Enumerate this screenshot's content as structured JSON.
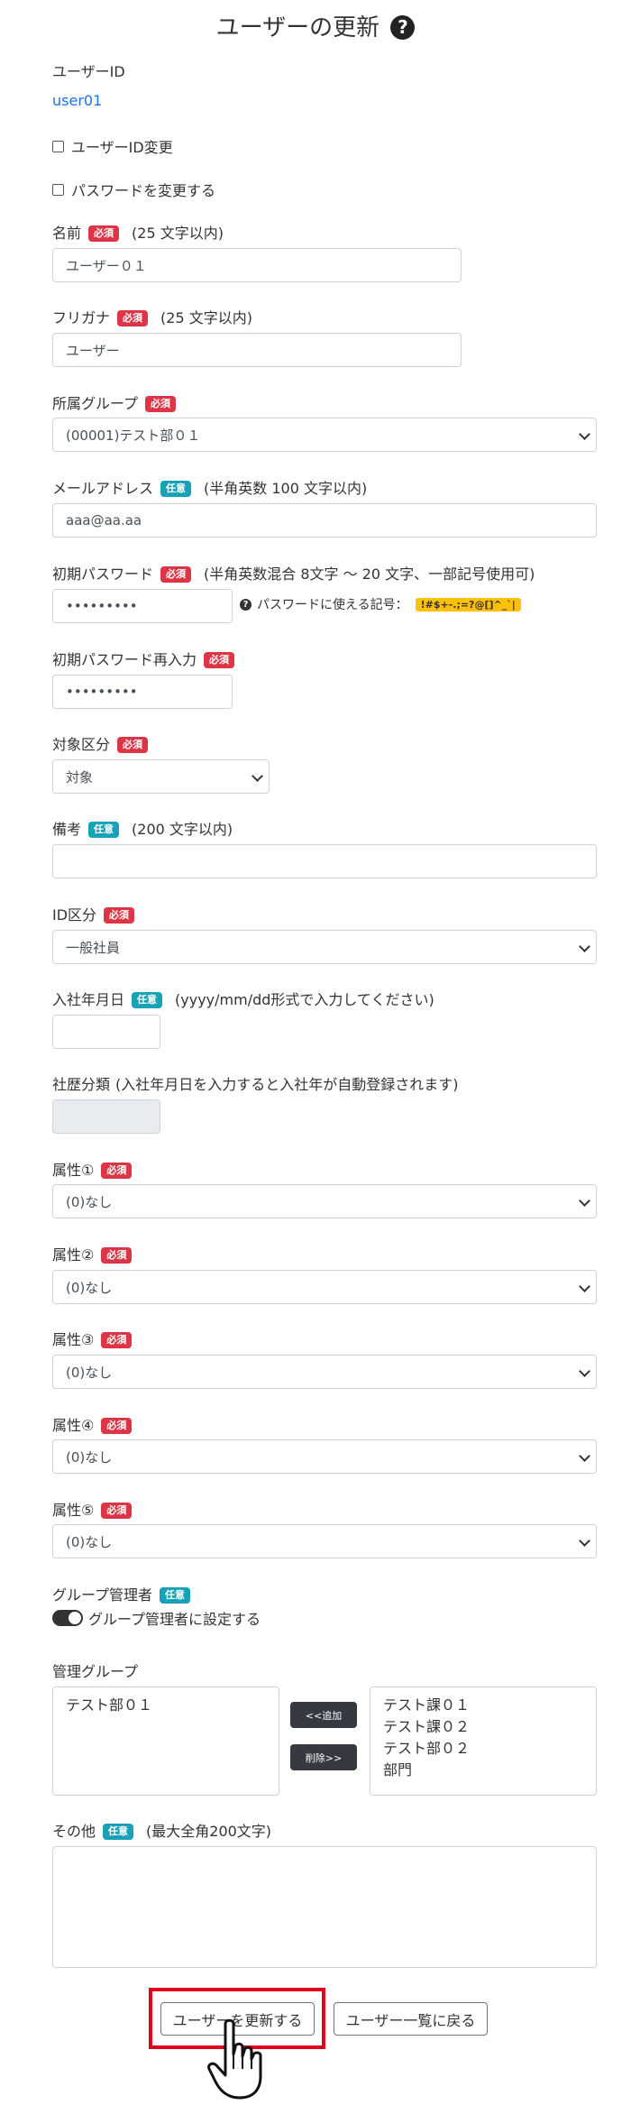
{
  "page": {
    "title": "ユーザーの更新",
    "help_symbol": "?"
  },
  "badges": {
    "required": "必須",
    "optional": "任意"
  },
  "user_id": {
    "label": "ユーザーID",
    "value": "user01"
  },
  "change_user_id": {
    "label": "ユーザーID変更"
  },
  "change_password": {
    "label": "パスワードを変更する"
  },
  "name": {
    "label": "名前",
    "note": "(25 文字以内)",
    "value": "ユーザー０１"
  },
  "furigana": {
    "label": "フリガナ",
    "note": "(25 文字以内)",
    "value": "ユーザー"
  },
  "group": {
    "label": "所属グループ",
    "value": "(00001)テスト部０１"
  },
  "email": {
    "label": "メールアドレス",
    "note": "(半角英数 100 文字以内)",
    "value": "aaa@aa.aa"
  },
  "initial_password": {
    "label": "初期パスワード",
    "note": "(半角英数混合 8文字 ～ 20 文字、一部記号使用可)",
    "value": "•••••••••",
    "help_symbol": "?",
    "symbols_label": "パスワードに使える記号：",
    "symbols": "!#$+-.;=?@[]^_`|"
  },
  "initial_password_confirm": {
    "label": "初期パスワード再入力",
    "value": "•••••••••"
  },
  "target_class": {
    "label": "対象区分",
    "value": "対象"
  },
  "remarks": {
    "label": "備考",
    "note": "(200 文字以内)",
    "value": ""
  },
  "id_class": {
    "label": "ID区分",
    "value": "一般社員"
  },
  "join_date": {
    "label": "入社年月日",
    "note": "(yyyy/mm/dd形式で入力してください)",
    "value": ""
  },
  "tenure_class": {
    "label": "社歴分類",
    "note": "(入社年月日を入力すると入社年が自動登録されます)",
    "value": ""
  },
  "attributes": [
    {
      "label": "属性①",
      "value": "(0)なし"
    },
    {
      "label": "属性②",
      "value": "(0)なし"
    },
    {
      "label": "属性③",
      "value": "(0)なし"
    },
    {
      "label": "属性④",
      "value": "(0)なし"
    },
    {
      "label": "属性⑤",
      "value": "(0)なし"
    }
  ],
  "group_admin": {
    "label": "グループ管理者",
    "toggle_label": "グループ管理者に設定する"
  },
  "managed_groups": {
    "label": "管理グループ",
    "selected": [
      "テスト部０１"
    ],
    "available": [
      "テスト課０１",
      "テスト課０２",
      "テスト部０２",
      "部門"
    ],
    "add_button": "<<追加",
    "remove_button": "削除>>"
  },
  "other": {
    "label": "その他",
    "note": "(最大全角200文字)",
    "value": ""
  },
  "actions": {
    "update_button": "ユーザーを更新する",
    "back_button": "ユーザー一覧に戻る"
  }
}
